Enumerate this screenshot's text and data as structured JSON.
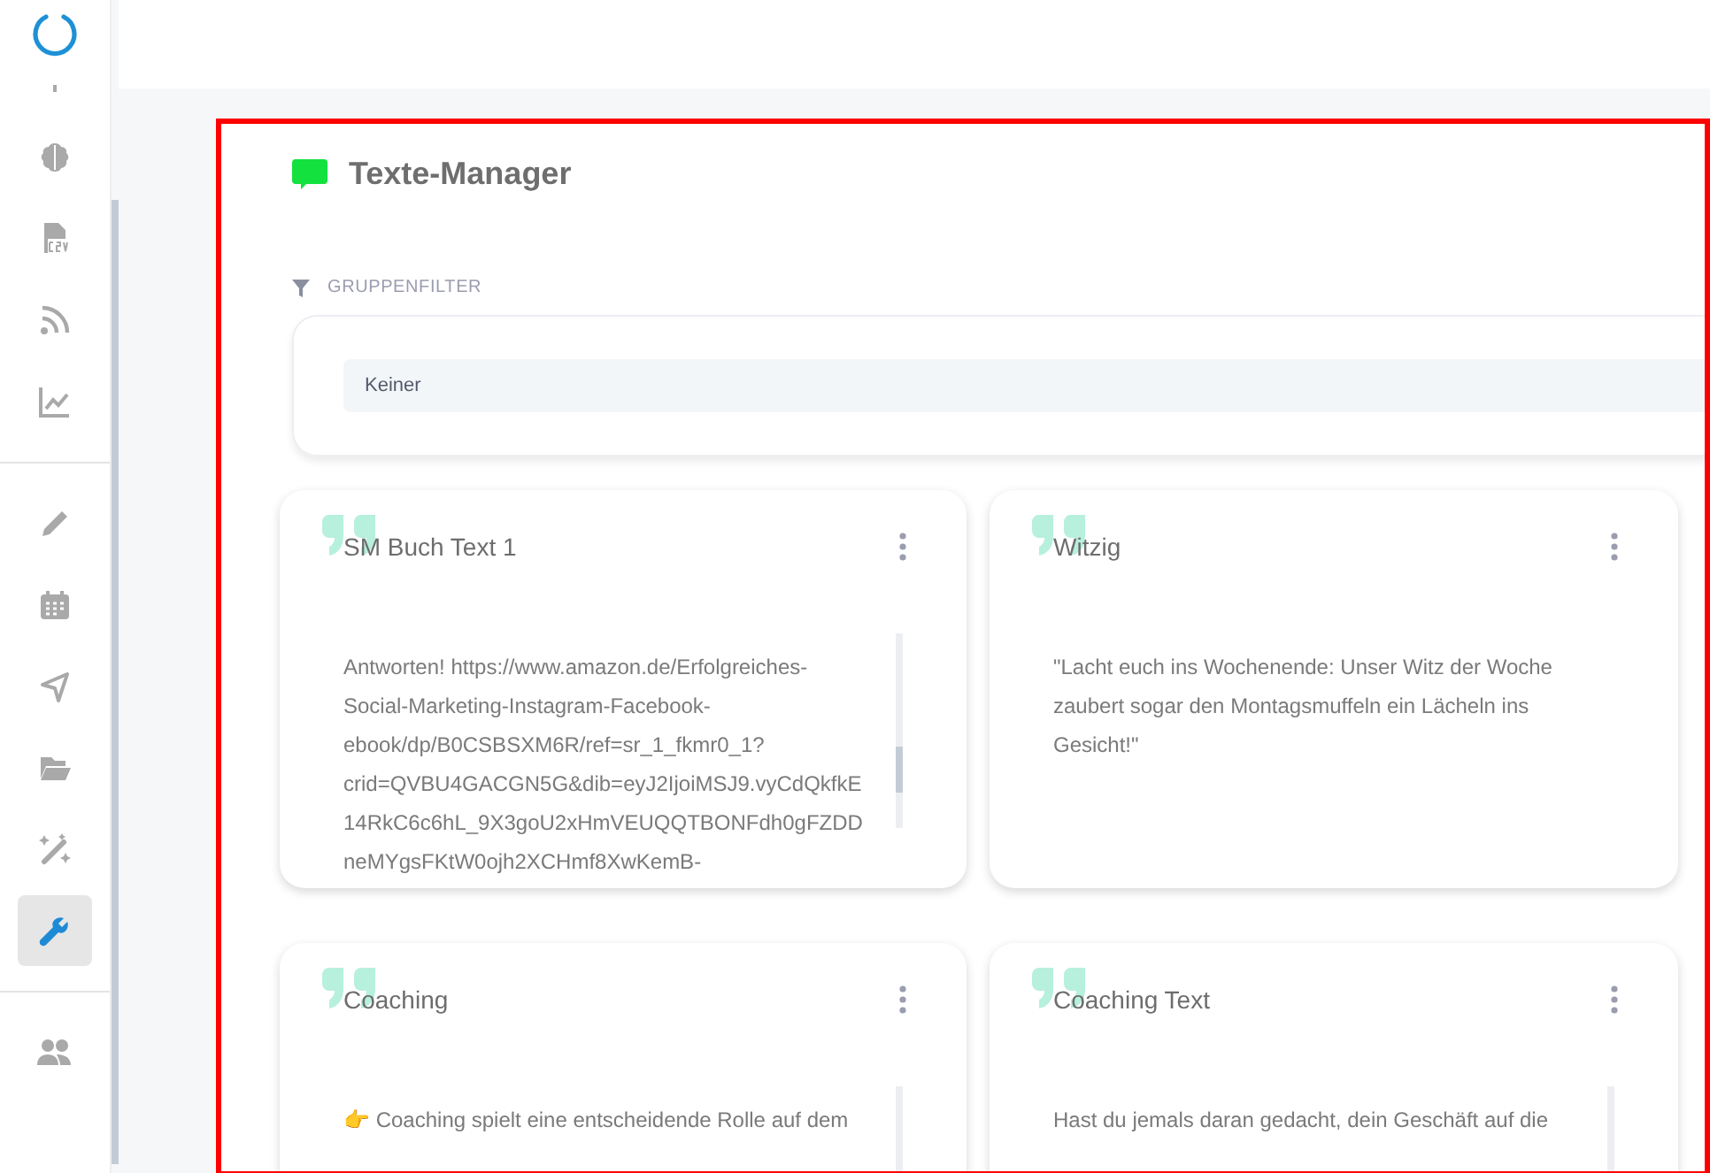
{
  "sidebar": {
    "groups": [
      {
        "items": [
          {
            "selected": false
          },
          {
            "selected": false
          },
          {
            "selected": false
          },
          {
            "selected": false
          }
        ]
      },
      {
        "items": [
          {
            "selected": false
          },
          {
            "selected": false
          },
          {
            "selected": false
          },
          {
            "selected": false
          },
          {
            "selected": false
          },
          {
            "selected": true
          }
        ]
      },
      {
        "items": [
          {
            "selected": false
          }
        ]
      }
    ]
  },
  "panel": {
    "title": "Texte-Manager",
    "filter_label": "GRUPPENFILTER",
    "filter_select": {
      "value": "Keiner"
    }
  },
  "cards": [
    {
      "title": "SM Buch Text 1",
      "kind": "scrolling",
      "lines": [
        "Antworten! https://www.amazon.de/Erfolgreiches-",
        "Social-Marketing-Instagram-Facebook-",
        "ebook/dp/B0CSBSXM6R/ref=sr_1_fkmr0_1?",
        "crid=QVBU4GACGN5G&dib=eyJ2IjoiMSJ9.vyCdQkfkE",
        "14RkC6c6hL_9X3goU2xHmVEUQQTBONFdh0gFZDD",
        "neMYgsFKtW0ojh2XCHmf8XwKemB-"
      ]
    },
    {
      "title": "Witzig",
      "kind": "plain",
      "lines": [
        "\"Lacht euch ins Wochenende: Unser Witz der Woche",
        "zaubert sogar den Montagsmuffeln ein Lächeln ins",
        "Gesicht!\""
      ]
    },
    {
      "title": "Coaching",
      "kind": "scrolling",
      "lines": [
        "👉 Coaching spielt eine entscheidende Rolle auf dem"
      ]
    },
    {
      "title": "Coaching Text",
      "kind": "scrolling",
      "lines": [
        "Hast du jemals daran gedacht, dein Geschäft auf die"
      ]
    }
  ]
}
